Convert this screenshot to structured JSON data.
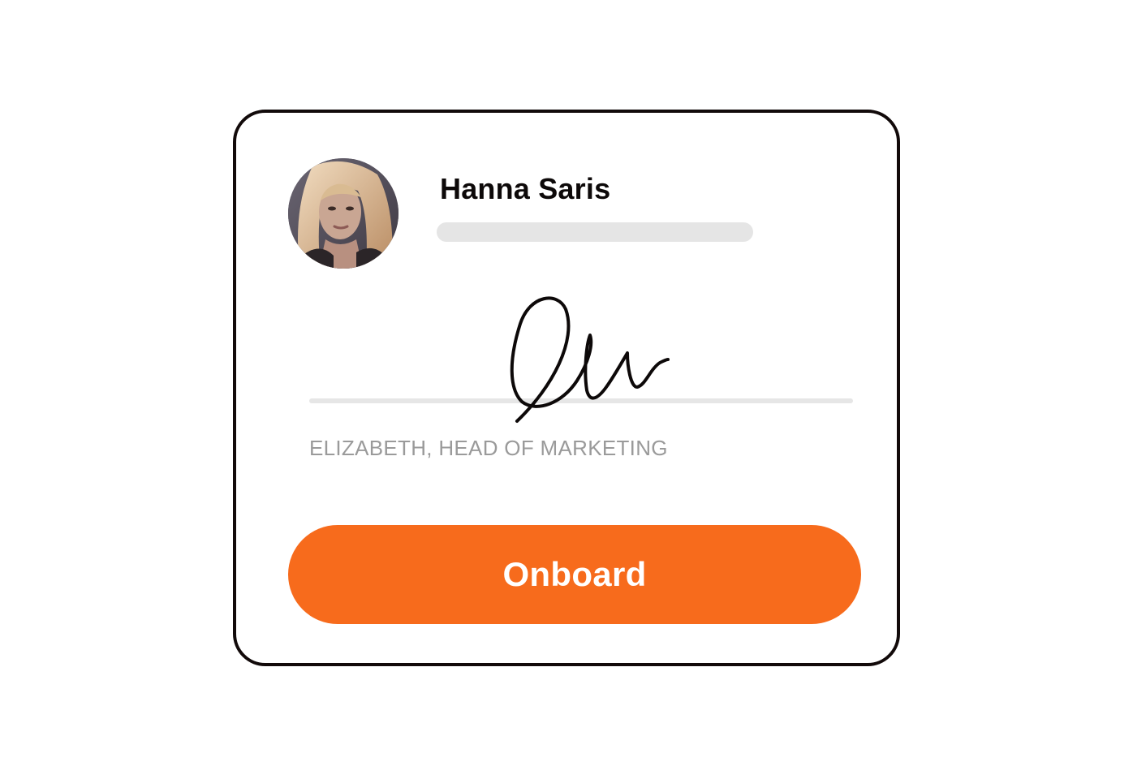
{
  "profile": {
    "name": "Hanna Saris",
    "avatar_icon": "person-photo"
  },
  "signature": {
    "signer_label": "ELIZABETH, HEAD OF MARKETING"
  },
  "actions": {
    "onboard_label": "Onboard"
  },
  "colors": {
    "accent": "#f76b1c",
    "card_border": "#120a0a",
    "placeholder": "#e5e5e5",
    "muted_text": "#9a9a9a"
  }
}
